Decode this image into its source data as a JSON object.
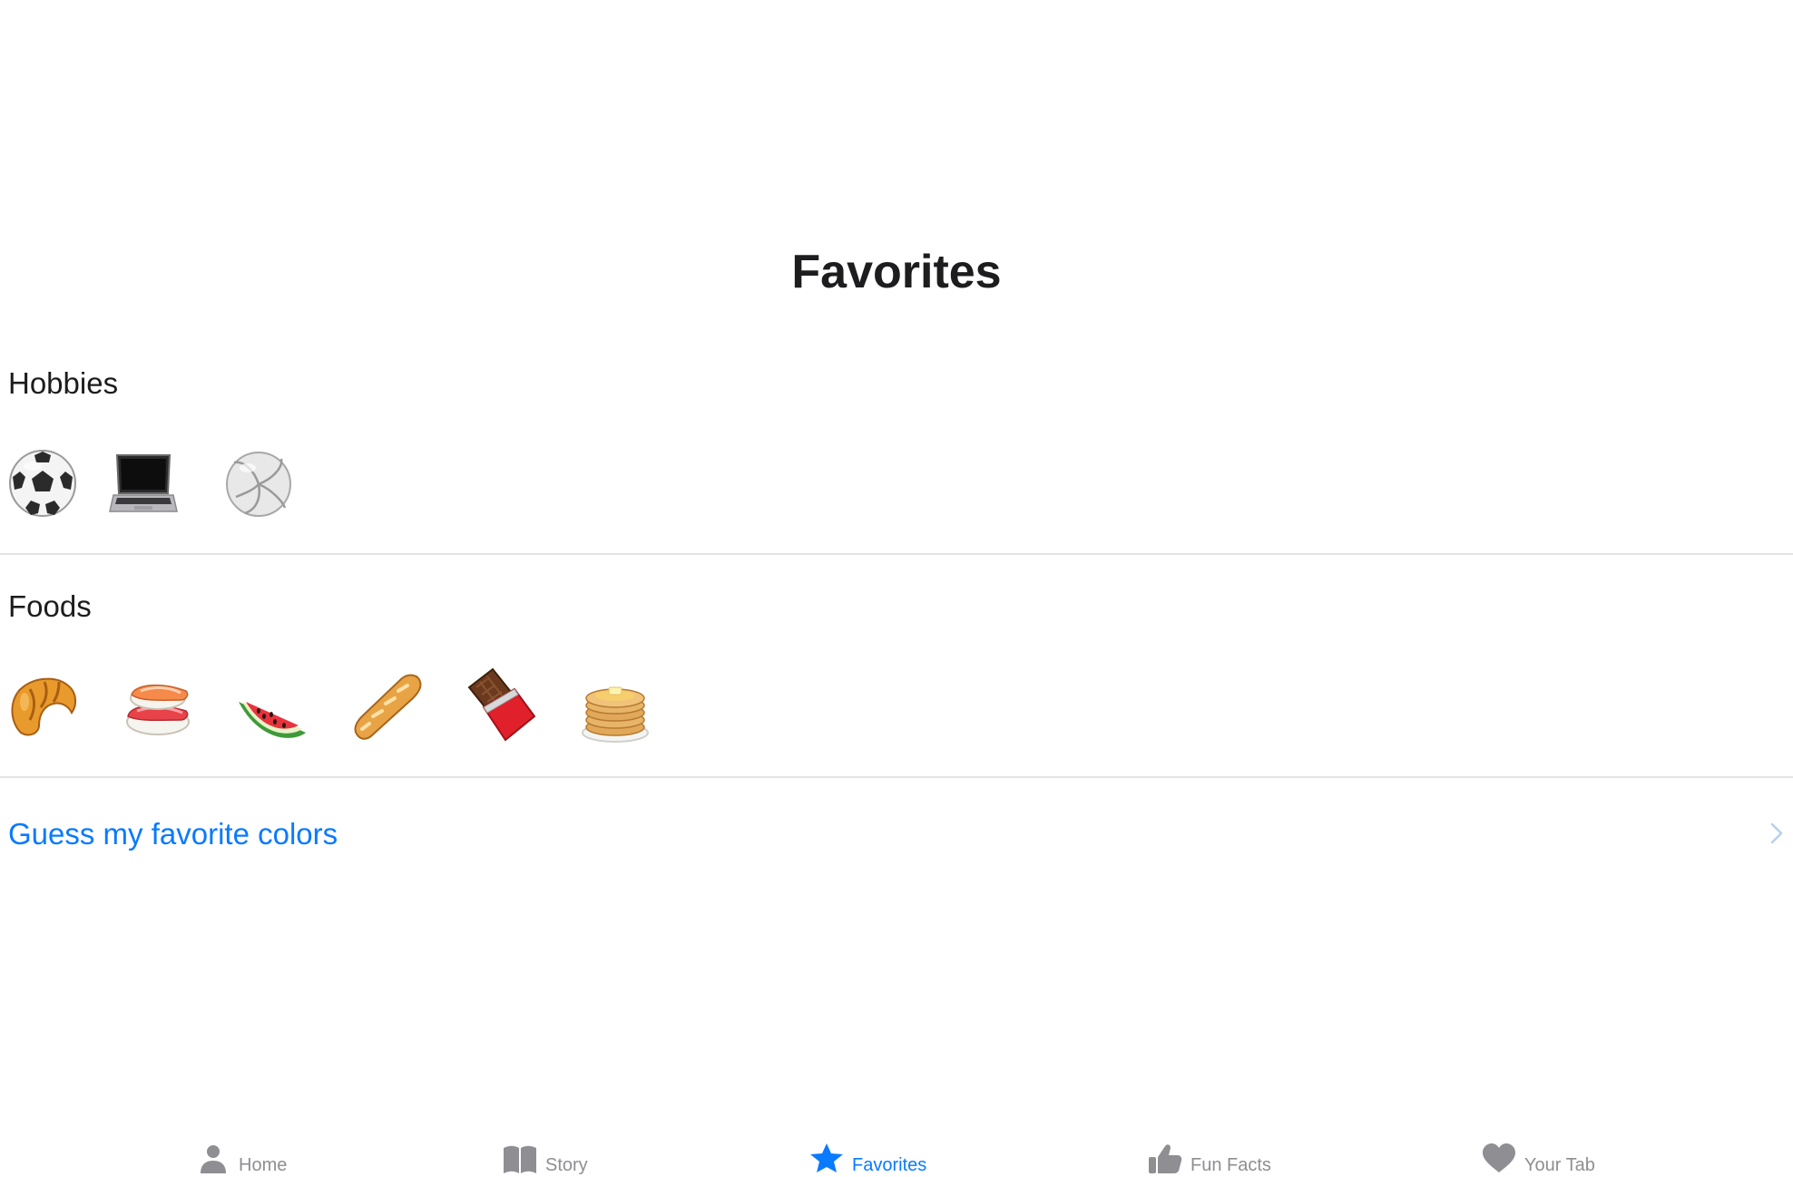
{
  "page": {
    "title": "Favorites"
  },
  "hobbies": {
    "heading": "Hobbies",
    "items": [
      "soccer-ball",
      "laptop",
      "volleyball"
    ]
  },
  "foods": {
    "heading": "Foods",
    "items": [
      "croissant",
      "sushi",
      "watermelon",
      "baguette",
      "chocolate-bar",
      "pancakes"
    ]
  },
  "link": {
    "label": "Guess my favorite colors"
  },
  "tabs": [
    {
      "label": "Home",
      "icon": "person-icon",
      "active": false
    },
    {
      "label": "Story",
      "icon": "book-icon",
      "active": false
    },
    {
      "label": "Favorites",
      "icon": "star-icon",
      "active": true
    },
    {
      "label": "Fun Facts",
      "icon": "thumbs-up-icon",
      "active": false
    },
    {
      "label": "Your Tab",
      "icon": "heart-icon",
      "active": false
    }
  ],
  "colors": {
    "accent": "#0a7aff",
    "inactive_tab": "#8e8e93",
    "text": "#1d1d1f",
    "divider": "#e3e3e6"
  }
}
